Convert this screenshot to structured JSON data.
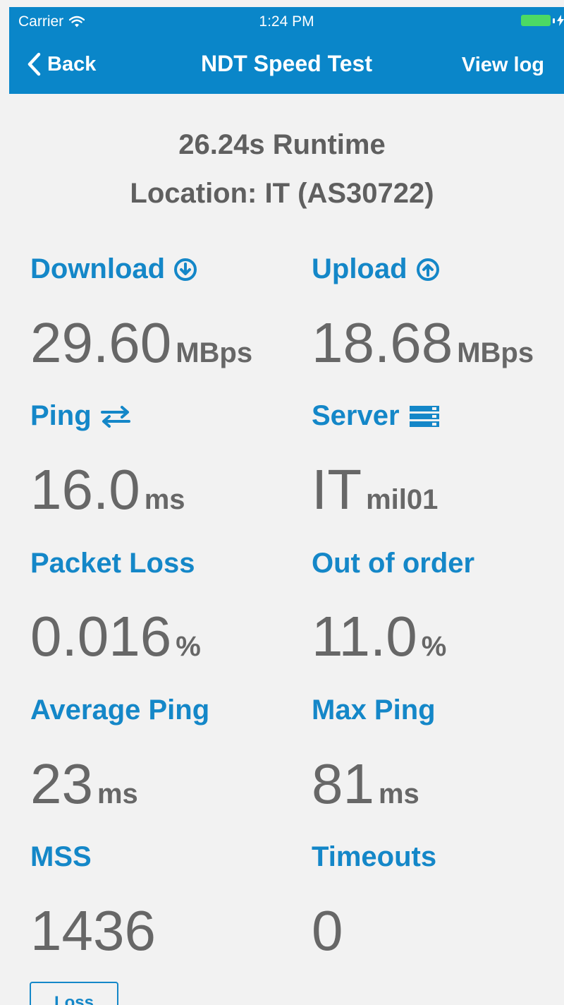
{
  "status_bar": {
    "carrier": "Carrier",
    "time": "1:24 PM"
  },
  "navbar": {
    "back_label": "Back",
    "title": "NDT Speed Test",
    "view_log_label": "View log"
  },
  "summary": {
    "runtime": "26.24s Runtime",
    "location": "Location: IT (AS30722)"
  },
  "metrics": {
    "download": {
      "label": "Download",
      "value": "29.60",
      "unit": "MBps"
    },
    "upload": {
      "label": "Upload",
      "value": "18.68",
      "unit": "MBps"
    },
    "ping": {
      "label": "Ping",
      "value": "16.0",
      "unit": "ms"
    },
    "server": {
      "label": "Server",
      "value": "IT",
      "unit": "mil01"
    },
    "packet_loss": {
      "label": "Packet Loss",
      "value": "0.016",
      "unit": "%"
    },
    "out_of_order": {
      "label": "Out of order",
      "value": "11.0",
      "unit": "%"
    },
    "average_ping": {
      "label": "Average Ping",
      "value": "23",
      "unit": "ms"
    },
    "max_ping": {
      "label": "Max Ping",
      "value": "81",
      "unit": "ms"
    },
    "mss": {
      "label": "MSS",
      "value": "1436"
    },
    "timeouts": {
      "label": "Timeouts",
      "value": "0"
    }
  },
  "footer": {
    "loss_button_label": "Loss"
  },
  "colors": {
    "accent": "#0a86c9",
    "label_blue": "#1487c8",
    "value_gray": "#676767",
    "background": "#f2f2f2",
    "battery_green": "#4cd964"
  },
  "icons": {
    "wifi": "wifi-icon",
    "battery": "battery-icon",
    "charging": "bolt-icon",
    "back": "chevron-left-icon",
    "download": "arrow-down-circle-icon",
    "upload": "arrow-up-circle-icon",
    "ping": "exchange-arrows-icon",
    "server": "server-icon"
  }
}
